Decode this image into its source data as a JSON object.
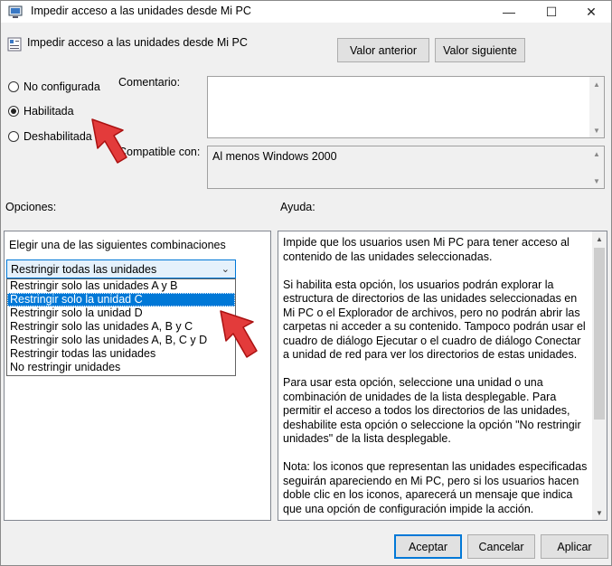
{
  "window": {
    "title": "Impedir acceso a las unidades desde Mi PC",
    "controls": {
      "minimize": "—",
      "maximize": "☐",
      "close": "✕"
    }
  },
  "header": {
    "policy_name": "Impedir acceso a las unidades desde Mi PC",
    "prev_button": "Valor anterior",
    "next_button": "Valor siguiente"
  },
  "state": {
    "options": [
      {
        "label": "No configurada",
        "selected": false
      },
      {
        "label": "Habilitada",
        "selected": true
      },
      {
        "label": "Deshabilitada",
        "selected": false
      }
    ]
  },
  "comment": {
    "label": "Comentario:",
    "value": ""
  },
  "supported": {
    "label": "Compatible con:",
    "value": "Al menos Windows 2000"
  },
  "options_section": {
    "label": "Opciones:",
    "combo_label": "Elegir una de las siguientes combinaciones",
    "combo_value": "Restringir todas las unidades",
    "dropdown_items": [
      {
        "label": "Restringir solo las unidades A y B",
        "selected": false
      },
      {
        "label": "Restringir solo la unidad C",
        "selected": true
      },
      {
        "label": "Restringir solo la unidad D",
        "selected": false
      },
      {
        "label": "Restringir solo las unidades A, B y C",
        "selected": false
      },
      {
        "label": "Restringir solo las unidades A, B, C y D",
        "selected": false
      },
      {
        "label": "Restringir todas las unidades",
        "selected": false
      },
      {
        "label": "No restringir unidades",
        "selected": false
      }
    ]
  },
  "help_section": {
    "label": "Ayuda:",
    "paragraphs": [
      "Impide que los usuarios usen Mi PC para tener acceso al contenido de las unidades seleccionadas.",
      "Si habilita esta opción, los usuarios podrán explorar la estructura de directorios de las unidades seleccionadas en Mi PC o el Explorador de archivos, pero no podrán abrir las carpetas ni acceder a su contenido. Tampoco podrán usar el cuadro de diálogo Ejecutar o el cuadro de diálogo Conectar a unidad de red para ver los directorios de estas unidades.",
      "Para usar esta opción, seleccione una unidad o una combinación de unidades de la lista desplegable. Para permitir el acceso a todos los directorios de las unidades, deshabilite esta opción o seleccione la opción \"No restringir unidades\" de la lista desplegable.",
      "Nota: los iconos que representan las unidades especificadas seguirán apareciendo en Mi PC, pero si los usuarios hacen doble clic en los iconos, aparecerá un mensaje que indica que una opción de configuración impide la acción."
    ]
  },
  "footer": {
    "ok": "Aceptar",
    "cancel": "Cancelar",
    "apply": "Aplicar"
  },
  "colors": {
    "selection": "#0078d7",
    "arrow": "#e33b3b"
  }
}
